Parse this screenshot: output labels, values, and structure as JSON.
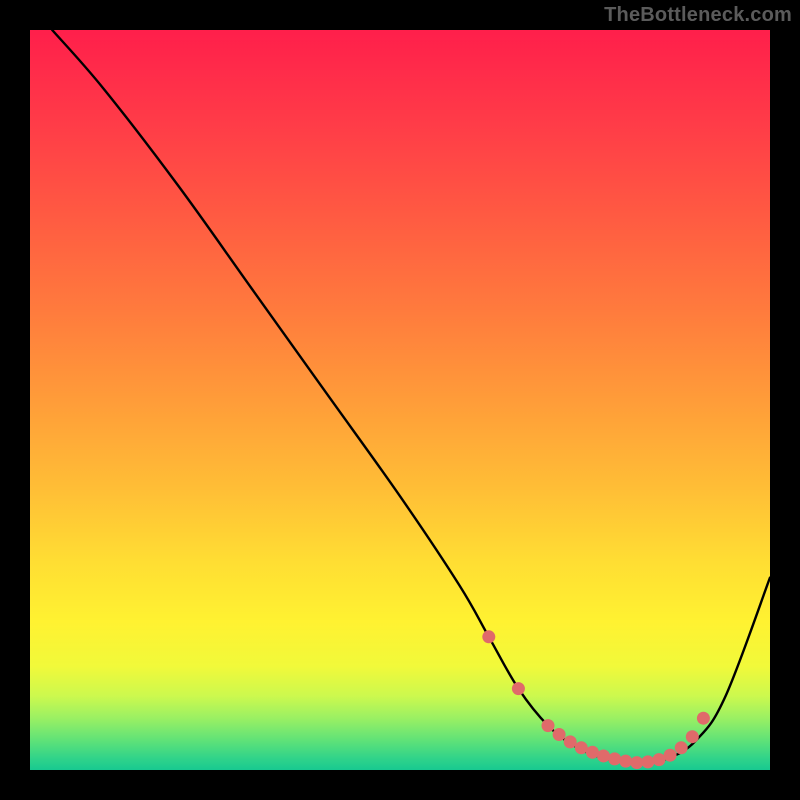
{
  "watermark": "TheBottleneck.com",
  "chart_data": {
    "type": "line",
    "title": "",
    "xlabel": "",
    "ylabel": "",
    "xlim": [
      0,
      100
    ],
    "ylim": [
      0,
      100
    ],
    "grid": false,
    "legend": false,
    "series": [
      {
        "name": "curve",
        "x": [
          3,
          10,
          20,
          30,
          40,
          50,
          58,
          62,
          66,
          70,
          74,
          78,
          82,
          86,
          90,
          94,
          100
        ],
        "y": [
          100,
          92,
          79,
          65,
          51,
          37,
          25,
          18,
          11,
          6,
          3,
          1.5,
          1,
          1.5,
          4,
          10,
          26
        ]
      }
    ],
    "highlight_points": {
      "name": "dotted-valley",
      "x": [
        62,
        66,
        70,
        71.5,
        73,
        74.5,
        76,
        77.5,
        79,
        80.5,
        82,
        83.5,
        85,
        86.5,
        88,
        89.5,
        91
      ],
      "y": [
        18,
        11,
        6,
        4.8,
        3.8,
        3,
        2.4,
        1.9,
        1.5,
        1.2,
        1,
        1.1,
        1.4,
        2,
        3,
        4.5,
        7
      ]
    },
    "gradient_stops": [
      {
        "offset": 0.0,
        "color": "#ff1f4b"
      },
      {
        "offset": 0.12,
        "color": "#ff3a48"
      },
      {
        "offset": 0.25,
        "color": "#ff5a42"
      },
      {
        "offset": 0.38,
        "color": "#ff7b3d"
      },
      {
        "offset": 0.5,
        "color": "#ff9c39"
      },
      {
        "offset": 0.62,
        "color": "#ffbe36"
      },
      {
        "offset": 0.72,
        "color": "#ffde33"
      },
      {
        "offset": 0.8,
        "color": "#fff231"
      },
      {
        "offset": 0.86,
        "color": "#f1f93a"
      },
      {
        "offset": 0.9,
        "color": "#ccf94e"
      },
      {
        "offset": 0.93,
        "color": "#9af063"
      },
      {
        "offset": 0.96,
        "color": "#5fe278"
      },
      {
        "offset": 0.985,
        "color": "#2fd38a"
      },
      {
        "offset": 1.0,
        "color": "#18c990"
      }
    ],
    "dot_color": "#e06a6a",
    "curve_color": "#000000",
    "curve_width": 2.4
  }
}
